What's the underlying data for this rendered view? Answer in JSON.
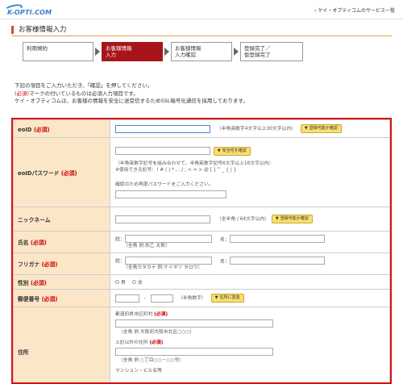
{
  "header": {
    "logo_text": "K-OPTI.COM",
    "service_link": "› ケイ・オプティコムのサービス一覧"
  },
  "page": {
    "title": "お客様情報入力"
  },
  "steps": [
    {
      "label": "利用規約"
    },
    {
      "label": "お客様情報\n入力"
    },
    {
      "label": "お客様情報\n入力確認"
    },
    {
      "label": "登録完了／\n仮登録完了"
    }
  ],
  "intro": {
    "line1": "下記の項目をご入力いただき、「確認」を押してください。",
    "line2_req": "(必須)",
    "line2_rest": "マークの付いているものは必須入力項目です。",
    "line3": "ケイ・オプティコムは、お客様の情報を安全に送受信するためSSL暗号化通信を採用しております。"
  },
  "form": {
    "required_mark": "(必須)",
    "eoid": {
      "label": "eoID",
      "note": "（半角英数字4文字以上30文字以内）",
      "button": "登録可能か確認"
    },
    "password": {
      "label": "eoIDパスワード",
      "button": "安全性を確認",
      "note1": "（半角英数字記号を組み合わせて、半角英数字記号6文字以上16文字以内）",
      "note2": "※使用できる記号：! # ( ) * , . / ; < = > @ [ ] ^ _ { | }",
      "confirm_note": "確認のため再度パスワードをご入力ください。"
    },
    "nickname": {
      "label": "ニックネーム",
      "note": "（全半角 / 64文字以内）",
      "button": "登録可能か確認"
    },
    "name": {
      "label": "氏名",
      "sei": "姓：",
      "mei": "名：",
      "note": "（全角 例:形乙 太郎）"
    },
    "furigana": {
      "label": "フリガナ",
      "sei": "姓：",
      "mei": "名：",
      "note": "（全角カタカナ 例:ケイオツ タロウ）"
    },
    "gender": {
      "label": "性別",
      "male": "男",
      "female": "女"
    },
    "postal": {
      "label": "郵便番号",
      "dash": "-",
      "note": "（半角数字）",
      "button": "住所に変換"
    },
    "address": {
      "label": "住所",
      "pref_label": "都道府県市区町村",
      "pref_note": "（全角 例 大阪府大阪市北区○○○）",
      "other_label": "上記以外の住所",
      "other_note": "（全角 例 ○丁目○○－○○号）",
      "building_label": "マンション・ビル名等"
    }
  },
  "colors": {
    "accent": "#a7151b",
    "label_bg": "#fbe7c8",
    "required": "#cc0000",
    "button": "#f9df6e",
    "form_border": "#d81010"
  }
}
